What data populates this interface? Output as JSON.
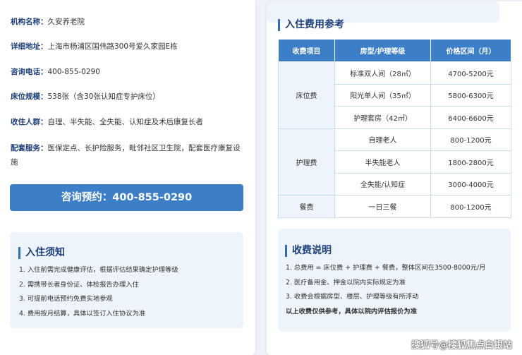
{
  "left": {
    "info": [
      {
        "label": "机构名称：",
        "value": "久安养老院"
      },
      {
        "label": "详细地址：",
        "value": "上海市杨浦区国伟路300号爱久家园E栋"
      },
      {
        "label": "咨询电话：",
        "value": "400-855-0290"
      },
      {
        "label": "床位规模：",
        "value": "538张（含30张认知症专护床位）"
      },
      {
        "label": "收住人群：",
        "value": "自理、半失能、全失能、认知症及术后康复长者"
      },
      {
        "label": "配套服务：",
        "value": "医保定点、长护险服务，毗邻社区卫生院，配套医疗康复设施"
      }
    ],
    "cta_label": "咨询预约：400-855-0290",
    "notice": {
      "title": "入住须知",
      "items": [
        "1. 入住前需完成健康评估，根据评估结果确定护理等级",
        "2. 需携带长者身份证、体检报告办理入住",
        "3. 可提前电话预约免费实地参观",
        "4. 费用按月结算，具体以签订入住协议为准"
      ]
    }
  },
  "right": {
    "fees_title": "入住费用参考",
    "table": {
      "headers": [
        "收费项目",
        "房型/护理等级",
        "价格区间（月）"
      ],
      "groups": [
        {
          "category": "床位费",
          "rows": [
            {
              "type": "标准双人间（28㎡）",
              "price": "4700-5200元"
            },
            {
              "type": "阳光单人间（35㎡）",
              "price": "5800-6300元"
            },
            {
              "type": "护理套房（42㎡）",
              "price": "6400-6600元"
            }
          ]
        },
        {
          "category": "护理费",
          "rows": [
            {
              "type": "自理老人",
              "price": "800-1200元"
            },
            {
              "type": "半失能老人",
              "price": "1800-2800元"
            },
            {
              "type": "全失能/认知症",
              "price": "3000-4000元"
            }
          ]
        },
        {
          "category": "餐费",
          "rows": [
            {
              "type": "一日三餐",
              "price": "800-1200元"
            }
          ]
        }
      ]
    },
    "explain": {
      "title": "收费说明",
      "items": [
        "1. 总费用 = 床位费 + 护理费 + 餐费，整体区间在3500-8000元/月",
        "2. 医疗备用金、押金以院内实际规定为准",
        "3. 收费会根据房型、楼层、护理等级有所浮动"
      ],
      "warning": "以上收费仅供参考，具体以院内评估报价为准"
    }
  },
  "watermark": "搜狐号@搜狐焦点白银站"
}
